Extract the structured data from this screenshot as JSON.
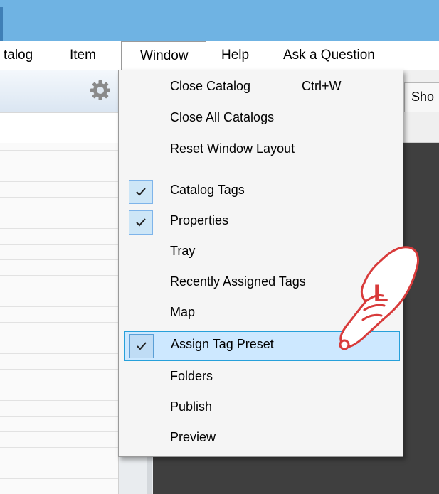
{
  "menubar": {
    "items": [
      "talog",
      "Item",
      "Window",
      "Help",
      "Ask a Question"
    ]
  },
  "toolbar": {
    "partial_tab": "Sho"
  },
  "dropdown": {
    "items": [
      {
        "label": "Close Catalog",
        "shortcut": "Ctrl+W",
        "checked": false
      },
      {
        "label": "Close All Catalogs",
        "checked": false
      },
      {
        "label": "Reset Window Layout",
        "checked": false
      },
      {
        "label": "Catalog Tags",
        "checked": true
      },
      {
        "label": "Properties",
        "checked": true
      },
      {
        "label": "Tray",
        "checked": false
      },
      {
        "label": "Recently Assigned Tags",
        "checked": false
      },
      {
        "label": "Map",
        "checked": false
      },
      {
        "label": "Assign Tag Preset",
        "checked": true,
        "highlighted": true
      },
      {
        "label": "Folders",
        "checked": false
      },
      {
        "label": "Publish",
        "checked": false
      },
      {
        "label": "Preview",
        "checked": false
      }
    ]
  },
  "annotation": {
    "hand_letter": "L",
    "icon": "pointing-hand-icon"
  },
  "colors": {
    "titlebar": "#6fb3e3",
    "highlight": "#cde8ff",
    "highlight_border": "#26a0da",
    "hand_red": "#d83b3b"
  }
}
